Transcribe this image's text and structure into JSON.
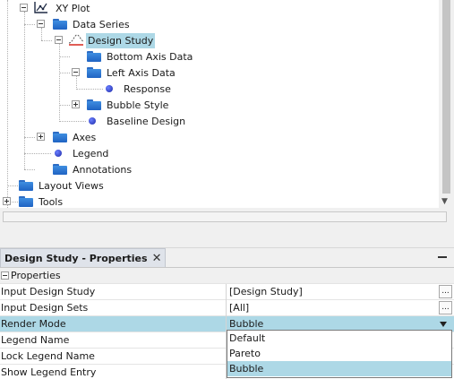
{
  "tree": {
    "items": [
      {
        "label": "XY Plot"
      },
      {
        "label": "Data Series"
      },
      {
        "label": "Design Study"
      },
      {
        "label": "Bottom Axis Data"
      },
      {
        "label": "Left Axis Data"
      },
      {
        "label": "Response"
      },
      {
        "label": "Bubble Style"
      },
      {
        "label": "Baseline Design"
      },
      {
        "label": "Axes"
      },
      {
        "label": "Legend"
      },
      {
        "label": "Annotations"
      },
      {
        "label": "Layout Views"
      },
      {
        "label": "Tools"
      }
    ],
    "selected_item": "Design Study"
  },
  "properties": {
    "tab_title": "Design Study - Properties",
    "close_glyph": "✕",
    "group_label": "Properties",
    "rows": [
      {
        "name": "Input Design Study",
        "value": "[Design Study]"
      },
      {
        "name": "Input Design Sets",
        "value": "[All]"
      },
      {
        "name": "Render Mode",
        "value": "Bubble"
      },
      {
        "name": "Legend Name",
        "value": ""
      },
      {
        "name": "Lock Legend Name",
        "value": ""
      },
      {
        "name": "Show Legend Entry",
        "value": ""
      }
    ],
    "ellipsis_label": "...",
    "render_mode_options": [
      "Default",
      "Pareto",
      "Bubble"
    ],
    "render_mode_selected": "Bubble"
  },
  "colors": {
    "selection": "#add8e6",
    "folder": "#2f7bd6",
    "node_dot": "#2233bb",
    "tab_bg": "#dfe3ea",
    "accent_curve": "#d9342b"
  },
  "icons": {
    "expanded": "minus-box",
    "collapsed": "plus-box",
    "folder": "folder-icon",
    "leaf": "dot-icon",
    "plot": "xy-plot-icon",
    "series": "design-study-curve-icon"
  }
}
